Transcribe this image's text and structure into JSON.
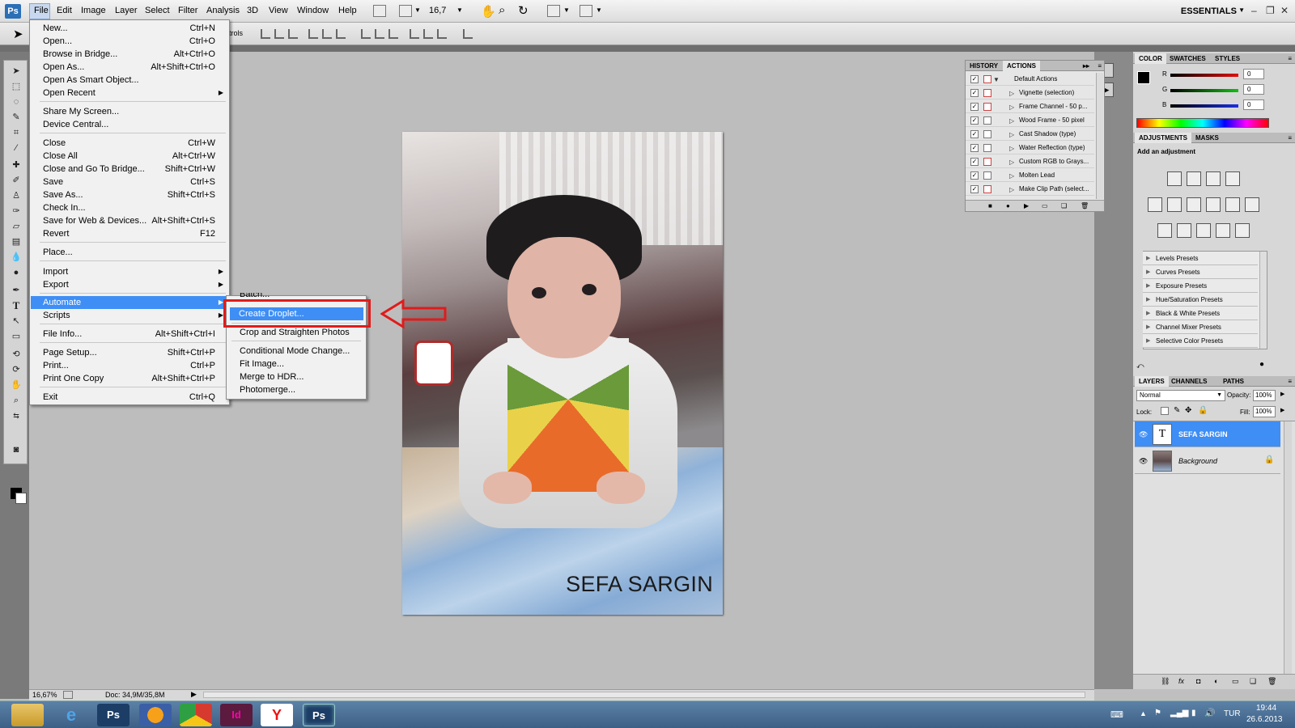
{
  "app": {
    "logo": "Ps"
  },
  "menubar": {
    "items": [
      "File",
      "Edit",
      "Image",
      "Layer",
      "Select",
      "Filter",
      "Analysis",
      "3D",
      "View",
      "Window",
      "Help"
    ],
    "zoom": "16,7",
    "workspace": "ESSENTIALS",
    "options_partial": "trols"
  },
  "file_menu": {
    "new": {
      "label": "New...",
      "shortcut": "Ctrl+N"
    },
    "open": {
      "label": "Open...",
      "shortcut": "Ctrl+O"
    },
    "browse": {
      "label": "Browse in Bridge...",
      "shortcut": "Alt+Ctrl+O"
    },
    "open_as": {
      "label": "Open As...",
      "shortcut": "Alt+Shift+Ctrl+O"
    },
    "open_smart": {
      "label": "Open As Smart Object..."
    },
    "open_recent": {
      "label": "Open Recent"
    },
    "share": {
      "label": "Share My Screen..."
    },
    "device_central": {
      "label": "Device Central..."
    },
    "close": {
      "label": "Close",
      "shortcut": "Ctrl+W"
    },
    "close_all": {
      "label": "Close All",
      "shortcut": "Alt+Ctrl+W"
    },
    "close_bridge": {
      "label": "Close and Go To Bridge...",
      "shortcut": "Shift+Ctrl+W"
    },
    "save": {
      "label": "Save",
      "shortcut": "Ctrl+S"
    },
    "save_as": {
      "label": "Save As...",
      "shortcut": "Shift+Ctrl+S"
    },
    "check_in": {
      "label": "Check In..."
    },
    "save_web": {
      "label": "Save for Web & Devices...",
      "shortcut": "Alt+Shift+Ctrl+S"
    },
    "revert": {
      "label": "Revert",
      "shortcut": "F12"
    },
    "place": {
      "label": "Place..."
    },
    "import": {
      "label": "Import"
    },
    "export": {
      "label": "Export"
    },
    "automate": {
      "label": "Automate"
    },
    "scripts": {
      "label": "Scripts"
    },
    "file_info": {
      "label": "File Info...",
      "shortcut": "Alt+Shift+Ctrl+I"
    },
    "page_setup": {
      "label": "Page Setup...",
      "shortcut": "Shift+Ctrl+P"
    },
    "print": {
      "label": "Print...",
      "shortcut": "Ctrl+P"
    },
    "print_one": {
      "label": "Print One Copy",
      "shortcut": "Alt+Shift+Ctrl+P"
    },
    "exit": {
      "label": "Exit",
      "shortcut": "Ctrl+Q"
    }
  },
  "automate_menu": {
    "batch": "Batch...",
    "create_droplet": "Create Droplet...",
    "crop_straighten": "Crop and Straighten Photos",
    "conditional_mode": "Conditional Mode Change...",
    "fit_image": "Fit Image...",
    "merge_hdr": "Merge to HDR...",
    "photomerge": "Photomerge..."
  },
  "document": {
    "caption": "SEFA SARGIN"
  },
  "statusbar": {
    "zoom": "16,67%",
    "doc": "Doc: 34,9M/35,8M"
  },
  "history_panel": {
    "tabs": [
      "HISTORY",
      "ACTIONS"
    ],
    "actions": [
      "Default Actions",
      "Vignette (selection)",
      "Frame Channel - 50 p...",
      "Wood Frame - 50 pixel",
      "Cast Shadow (type)",
      "Water Reflection (type)",
      "Custom RGB to Grays...",
      "Molten Lead",
      "Make Clip Path (select..."
    ]
  },
  "color_panel": {
    "tabs": [
      "COLOR",
      "SWATCHES",
      "STYLES"
    ],
    "r_label": "R",
    "g_label": "G",
    "b_label": "B",
    "r": "0",
    "g": "0",
    "b": "0"
  },
  "adjustments_panel": {
    "tabs": [
      "ADJUSTMENTS",
      "MASKS"
    ],
    "title": "Add an adjustment",
    "presets": [
      "Levels Presets",
      "Curves Presets",
      "Exposure Presets",
      "Hue/Saturation Presets",
      "Black & White Presets",
      "Channel Mixer Presets",
      "Selective Color Presets"
    ]
  },
  "layers_panel": {
    "tabs": [
      "LAYERS",
      "CHANNELS",
      "PATHS"
    ],
    "blend_mode": "Normal",
    "opacity_label": "Opacity:",
    "opacity": "100%",
    "lock_label": "Lock:",
    "fill_label": "Fill:",
    "fill": "100%",
    "layers": [
      {
        "name": "SEFA SARGIN"
      },
      {
        "name": "Background"
      }
    ]
  },
  "taskbar": {
    "language": "TUR",
    "time": "19:44",
    "date": "26.6.2013",
    "apps": [
      "Ps",
      "Id",
      "Ps"
    ]
  },
  "colors": {
    "accent": "#3e8ef5",
    "highlight_box": "#e11b1b",
    "layer_selected": "#3e8ef5"
  }
}
